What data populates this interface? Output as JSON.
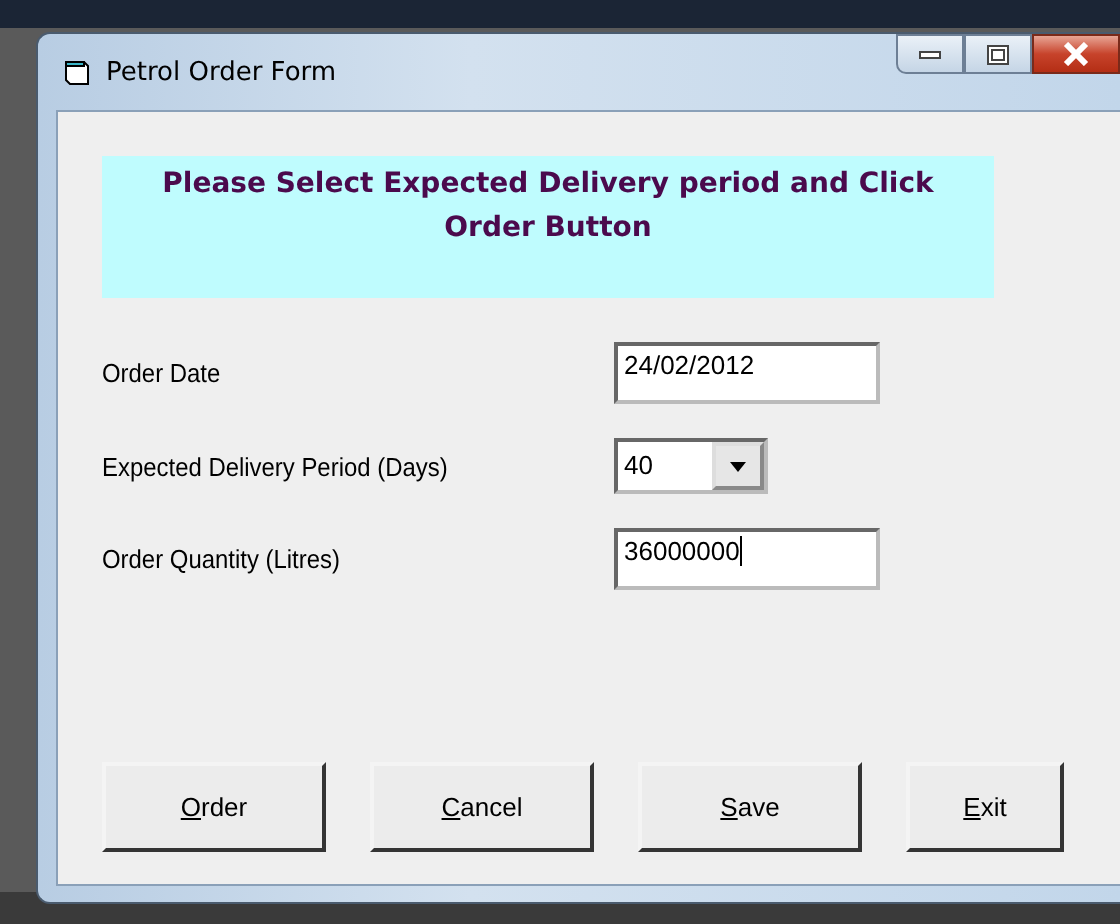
{
  "window": {
    "title": "Petrol Order Form"
  },
  "banner": "Please Select Expected Delivery period and Click Order   Button",
  "fields": [
    {
      "kind": "text",
      "label": "Order Date",
      "value": "24/02/2012",
      "focused": false
    },
    {
      "kind": "combo",
      "label": "Expected Delivery Period (Days)",
      "value": "40",
      "focused": false
    },
    {
      "kind": "text",
      "label": "Order Quantity (Litres)",
      "value": "36000000",
      "focused": true
    }
  ],
  "buttons": [
    "Order",
    "Cancel",
    "Save",
    "Exit"
  ]
}
